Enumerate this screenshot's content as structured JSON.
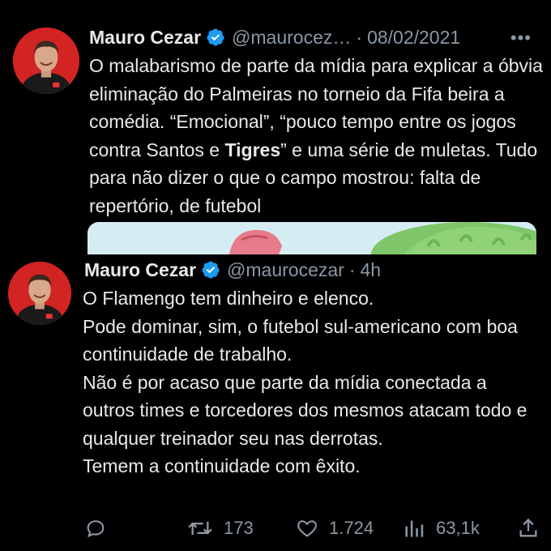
{
  "tweets": [
    {
      "author_name": "Mauro Cezar",
      "handle": "@maurocez…",
      "separator": "·",
      "date": "08/02/2021",
      "more": "•••",
      "text_part1": "O malabarismo de parte da mídia para explicar a óbvia eliminação do Palmeiras no torneio da Fifa beira a comédia. “Emocional”, “pouco tempo entre os jogos contra Santos e ",
      "text_bold": "Tigres",
      "text_part2": "” e uma série de muletas. Tudo para não dizer o que o campo mostrou: falta de repertório, de futebol"
    },
    {
      "author_name": "Mauro Cezar",
      "handle": "@maurocezar",
      "separator": "·",
      "date": "4h",
      "text": "O Flamengo tem dinheiro e elenco.\nPode dominar, sim, o futebol sul-americano com boa continuidade de trabalho.\nNão é por acaso que parte da mídia conectada a outros times e torcedores dos mesmos atacam todo e qualquer treinador seu nas derrotas.\nTemem a continuidade com êxito.",
      "actions": {
        "reply_icon": "reply-icon",
        "retweet_icon": "retweet-icon",
        "retweet_count": "173",
        "like_icon": "heart-icon",
        "like_count": "1.724",
        "views_icon": "views-icon",
        "views_count": "63,1k",
        "share_icon": "share-icon"
      }
    }
  ],
  "colors": {
    "background": "#000000",
    "text": "#e7e9ea",
    "secondary": "#8b98a5",
    "verified": "#1d9bf0",
    "avatar": "#d32424"
  }
}
